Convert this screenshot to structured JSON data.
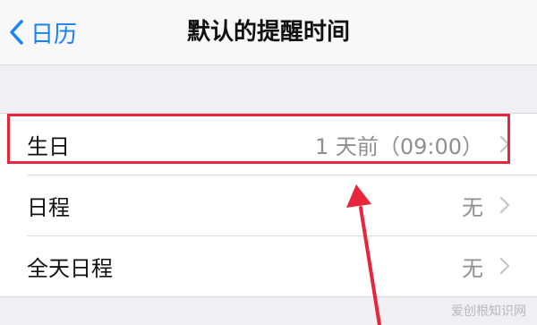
{
  "navbar": {
    "back_label": "日历",
    "title": "默认的提醒时间"
  },
  "rows": [
    {
      "label": "生日",
      "value": "1 天前（09:00）"
    },
    {
      "label": "日程",
      "value": "无"
    },
    {
      "label": "全天日程",
      "value": "无"
    }
  ],
  "watermark": "爱创根知识网",
  "colors": {
    "accent": "#1a82f7",
    "highlight": "#e8253a"
  },
  "icons": {
    "back": "chevron-left-icon",
    "disclosure": "chevron-right-icon",
    "annotation": "red-arrow"
  }
}
